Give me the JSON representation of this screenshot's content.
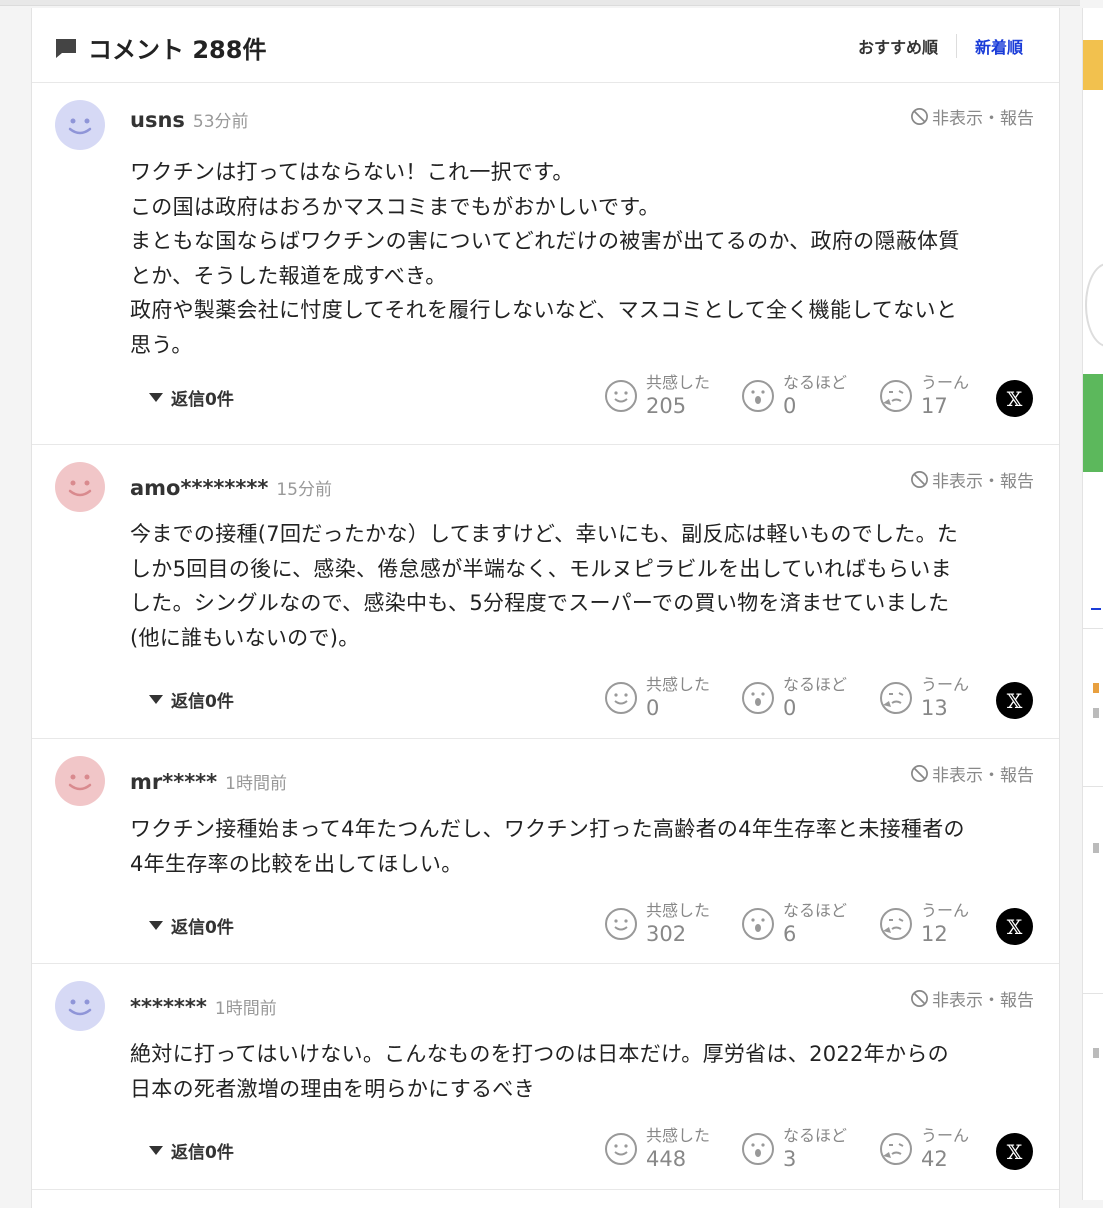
{
  "header": {
    "title": "コメント 288件",
    "sort_recommended": "おすすめ順",
    "sort_newest": "新着順"
  },
  "labels": {
    "hide_report": "非表示・報告",
    "empathize": "共感した",
    "i_see": "なるほど",
    "hmm": "うーん",
    "x_icon": "𝕏"
  },
  "comments": [
    {
      "username": "usns",
      "time": "53分前",
      "avatar_color": "blue",
      "lines": [
        "ワクチンは打ってはならない！これ一択です。",
        "この国は政府はおろかマスコミまでもがおかしいです。",
        "まともな国ならばワクチンの害についてどれだけの被害が出てるのか、政府の隠蔽体質",
        "とか、そうした報道を成すべき。",
        "政府や製薬会社に忖度してそれを履行しないなど、マスコミとして全く機能してないと",
        "思う。"
      ],
      "replies": "返信0件",
      "empathize_count": "205",
      "i_see_count": "0",
      "hmm_count": "17"
    },
    {
      "username": "amo********",
      "time": "15分前",
      "avatar_color": "pink",
      "lines": [
        "今までの接種(7回だったかな）してますけど、幸いにも、副反応は軽いものでした。た",
        "しか5回目の後に、感染、倦怠感が半端なく、モルヌピラビルを出していればもらいま",
        "した。シングルなので、感染中も、5分程度でスーパーでの買い物を済ませていました",
        "(他に誰もいないので)。"
      ],
      "replies": "返信0件",
      "empathize_count": "0",
      "i_see_count": "0",
      "hmm_count": "13"
    },
    {
      "username": "mr*****",
      "time": "1時間前",
      "avatar_color": "pink",
      "lines": [
        "ワクチン接種始まって4年たつんだし、ワクチン打った高齢者の4年生存率と未接種者の",
        "4年生存率の比較を出してほしい。"
      ],
      "replies": "返信0件",
      "empathize_count": "302",
      "i_see_count": "6",
      "hmm_count": "12"
    },
    {
      "username": "*******",
      "time": "1時間前",
      "avatar_color": "blue",
      "lines": [
        "絶対に打ってはいけない。こんなものを打つのは日本だけ。厚労省は、2022年からの",
        "日本の死者激増の理由を明らかにするべき"
      ],
      "replies": "返信0件",
      "empathize_count": "448",
      "i_see_count": "3",
      "hmm_count": "42"
    }
  ]
}
